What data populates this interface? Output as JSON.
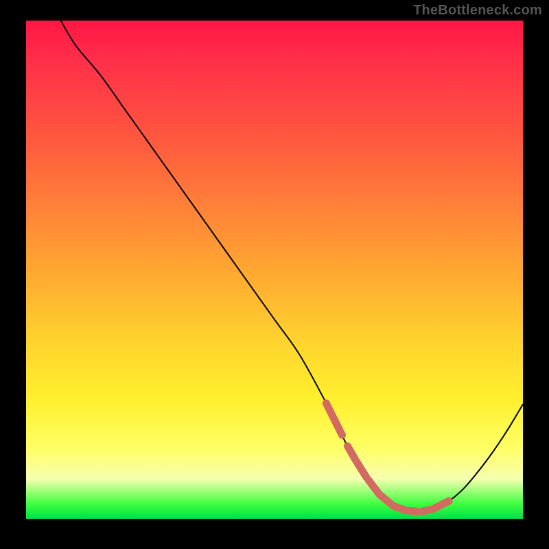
{
  "watermark": "TheBottleneck.com",
  "chart_data": {
    "type": "line",
    "title": "",
    "xlabel": "",
    "ylabel": "",
    "xlim": [
      0,
      100
    ],
    "ylim": [
      0,
      100
    ],
    "grid": false,
    "legend": false,
    "series": [
      {
        "name": "bottleneck-curve",
        "x": [
          7,
          10,
          15,
          20,
          25,
          30,
          35,
          40,
          45,
          50,
          55,
          60,
          62,
          65,
          68,
          71,
          74,
          77,
          80,
          82,
          85,
          88,
          91,
          94,
          97,
          100
        ],
        "values": [
          100,
          95,
          89,
          82,
          75,
          68,
          61,
          54,
          47,
          40,
          33,
          24,
          20,
          14,
          9,
          5,
          2.5,
          1.5,
          1.5,
          2,
          3.5,
          6,
          9.5,
          13.5,
          18,
          23
        ]
      }
    ],
    "optimum_dashes_x": [
      62,
      65.5,
      67.5,
      70,
      72.5,
      75,
      77.5,
      80.5,
      83.5
    ],
    "optimum_dashes_len": [
      3.2,
      1.6,
      2.0,
      2.2,
      2.2,
      2.2,
      2.2,
      1.6,
      3.2
    ],
    "colors": {
      "gradient_top": "#ff1744",
      "gradient_mid": "#ffd22e",
      "gradient_bottom": "#00e04a",
      "curve": "#000000",
      "dashes": "#d36a62",
      "background": "#000000",
      "watermark": "#555555"
    }
  }
}
